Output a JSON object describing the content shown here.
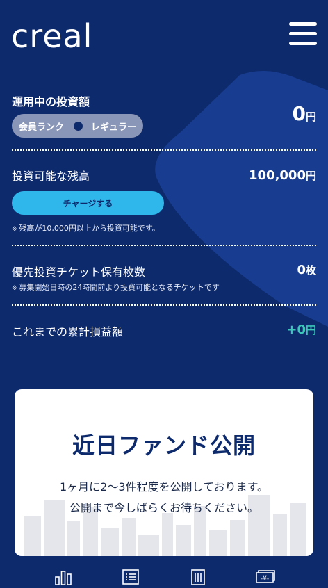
{
  "header": {
    "logo": "creal",
    "menu_icon": "hamburger-menu-icon"
  },
  "investing": {
    "label": "運用中の投資額",
    "amount": "0",
    "unit": "円",
    "rank_label": "会員ランク",
    "rank_value": "レギュラー"
  },
  "balance": {
    "label": "投資可能な残高",
    "amount": "100,000",
    "unit": "円",
    "charge_button": "チャージする",
    "note": "残高が10,000円以上から投資可能です。"
  },
  "tickets": {
    "label": "優先投資チケット保有枚数",
    "amount": "0",
    "unit": "枚",
    "note": "募集開始日時の24時間前より投資可能となるチケットです"
  },
  "profit": {
    "label": "これまでの累計損益額",
    "amount": "+0",
    "unit": "円",
    "color": "#3cc7b9"
  },
  "fund_card": {
    "title": "近日ファンド公開",
    "line1": "1ヶ月に2〜3件程度を公開しております。",
    "line2": "公開まで今しばらくお待ちください。"
  },
  "bottom_nav": {
    "icons": [
      "bar-chart-icon",
      "list-icon",
      "building-icon",
      "yen-bill-icon"
    ]
  },
  "colors": {
    "background": "#0d2a6d",
    "accent": "#2fb6ea",
    "profit": "#3cc7b9"
  }
}
